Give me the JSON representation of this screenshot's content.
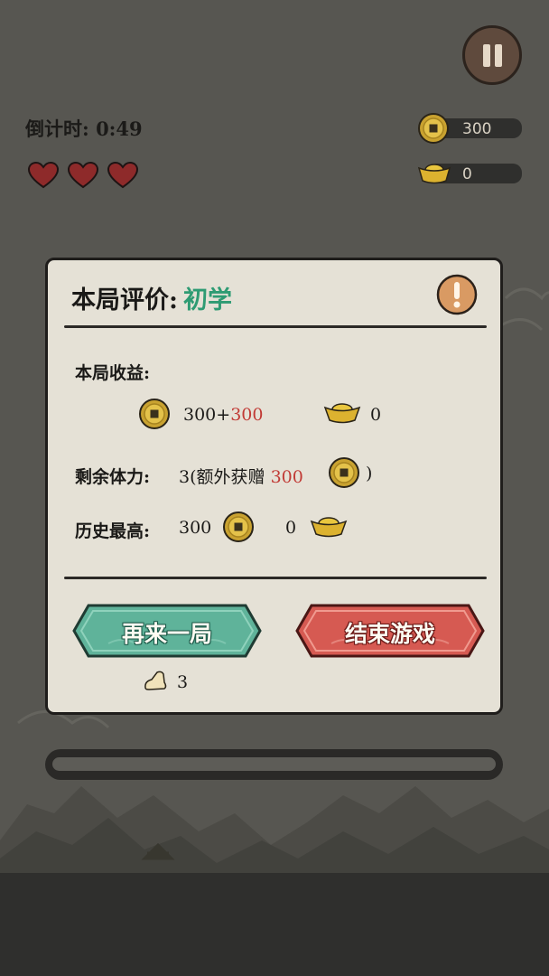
{
  "hud": {
    "countdown_label": "倒计时: 0:49",
    "lives": 3,
    "coins": "300",
    "ingots": "0"
  },
  "dialog": {
    "title_label": "本局评价:",
    "rank": "初学",
    "earnings_label": "本局收益:",
    "earnings_coins_base": "300+",
    "earnings_coins_bonus": "300",
    "earnings_ingots": "0",
    "stamina_label": "剩余体力:",
    "stamina_prefix": "3(额外获赠",
    "stamina_bonus": "300",
    "stamina_suffix": ")",
    "best_label": "历史最高:",
    "best_coins": "300",
    "best_ingots": "0",
    "replay_label": "再来一局",
    "end_label": "结束游戏",
    "stamina_cost": "3"
  },
  "progress": {
    "fraction": 0.0
  },
  "colors": {
    "rank": "#2e9b73",
    "bonus_red": "#c13a35",
    "replay_button": "#5fb39a",
    "end_button": "#d65a52",
    "heart": "#8e2a2a"
  },
  "icons": [
    "pause-icon",
    "heart-icon",
    "coin-icon",
    "ingot-icon",
    "info-icon",
    "footprint-icon"
  ]
}
